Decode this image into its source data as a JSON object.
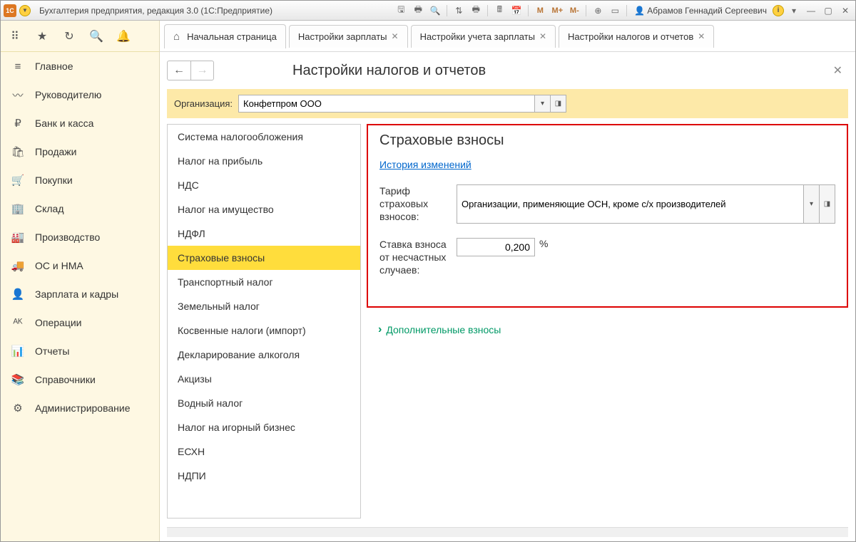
{
  "title": "Бухгалтерия предприятия, редакция 3.0  (1С:Предприятие)",
  "user": "Абрамов Геннадий Сергеевич",
  "toolbar_m": [
    "M",
    "M+",
    "M-"
  ],
  "sidebar": {
    "items": [
      {
        "icon": "≡",
        "label": "Главное"
      },
      {
        "icon": "〰",
        "label": "Руководителю"
      },
      {
        "icon": "₽",
        "label": "Банк и касса"
      },
      {
        "icon": "🛍",
        "label": "Продажи"
      },
      {
        "icon": "🛒",
        "label": "Покупки"
      },
      {
        "icon": "🏢",
        "label": "Склад"
      },
      {
        "icon": "🏭",
        "label": "Производство"
      },
      {
        "icon": "🚚",
        "label": "ОС и НМА"
      },
      {
        "icon": "👤",
        "label": "Зарплата и кадры"
      },
      {
        "icon": "ᴬᴷ",
        "label": "Операции"
      },
      {
        "icon": "📊",
        "label": "Отчеты"
      },
      {
        "icon": "📚",
        "label": "Справочники"
      },
      {
        "icon": "⚙",
        "label": "Администрирование"
      }
    ]
  },
  "tabs": [
    {
      "label": "Начальная страница",
      "closable": false,
      "home": true
    },
    {
      "label": "Настройки зарплаты",
      "closable": true
    },
    {
      "label": "Настройки учета зарплаты",
      "closable": true
    },
    {
      "label": "Настройки налогов и отчетов",
      "closable": true
    }
  ],
  "page": {
    "title": "Настройки налогов и отчетов",
    "org_label": "Организация:",
    "org_value": "Конфетпром ООО"
  },
  "left_list": [
    "Система налогообложения",
    "Налог на прибыль",
    "НДС",
    "Налог на имущество",
    "НДФЛ",
    "Страховые взносы",
    "Транспортный налог",
    "Земельный налог",
    "Косвенные налоги (импорт)",
    "Декларирование алкоголя",
    "Акцизы",
    "Водный налог",
    "Налог на игорный бизнес",
    "ЕСХН",
    "НДПИ"
  ],
  "left_active_index": 5,
  "panel": {
    "title": "Страховые взносы",
    "history_link": "История изменений",
    "tariff_label": "Тариф страховых взносов:",
    "tariff_value": "Организации, применяющие ОСН, кроме с/х производителей",
    "rate_label": "Ставка взноса от несчастных случаев:",
    "rate_value": "0,200",
    "rate_unit": "%",
    "extra": "Дополнительные взносы"
  }
}
